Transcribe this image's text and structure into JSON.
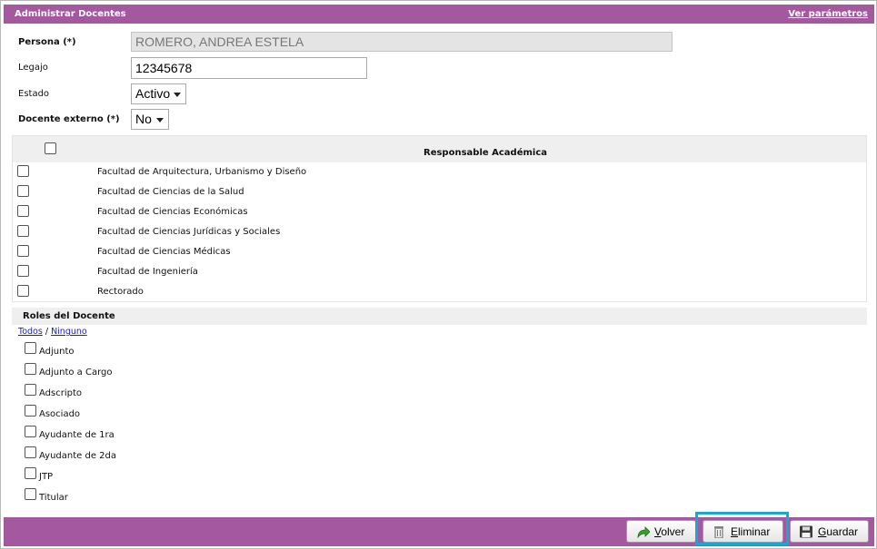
{
  "window": {
    "title": "Administrar Docentes",
    "params_link": "Ver parámetros"
  },
  "form": {
    "persona_label": "Persona (*)",
    "persona_value": "ROMERO, ANDREA ESTELA",
    "legajo_label": "Legajo",
    "legajo_value": "12345678",
    "estado_label": "Estado",
    "estado_value": "Activo",
    "externo_label": "Docente externo (*)",
    "externo_value": "No"
  },
  "responsable": {
    "header": "Responsable Académica",
    "rows": [
      "Facultad de Arquitectura, Urbanismo y Diseño",
      "Facultad de Ciencias de la Salud",
      "Facultad de Ciencias Económicas",
      "Facultad de Ciencias Jurídicas y Sociales",
      "Facultad de Ciencias Médicas",
      "Facultad de Ingeniería",
      "Rectorado"
    ]
  },
  "roles": {
    "header": "Roles del Docente",
    "todos_link": "Todos",
    "separator": "/",
    "ninguno_link": "Ninguno",
    "items": [
      "Adjunto",
      "Adjunto a Cargo",
      "Adscripto",
      "Asociado",
      "Ayudante de 1ra",
      "Ayudante de 2da",
      "JTP",
      "Titular"
    ]
  },
  "buttons": {
    "volver_u": "V",
    "volver_rest": "olver",
    "eliminar_u": "E",
    "eliminar_rest": "liminar",
    "guardar_u": "G",
    "guardar_rest": "uardar"
  },
  "colors": {
    "titlebar": "#a4589f",
    "highlight": "#1aa6d2",
    "link": "#1a1ad6"
  }
}
